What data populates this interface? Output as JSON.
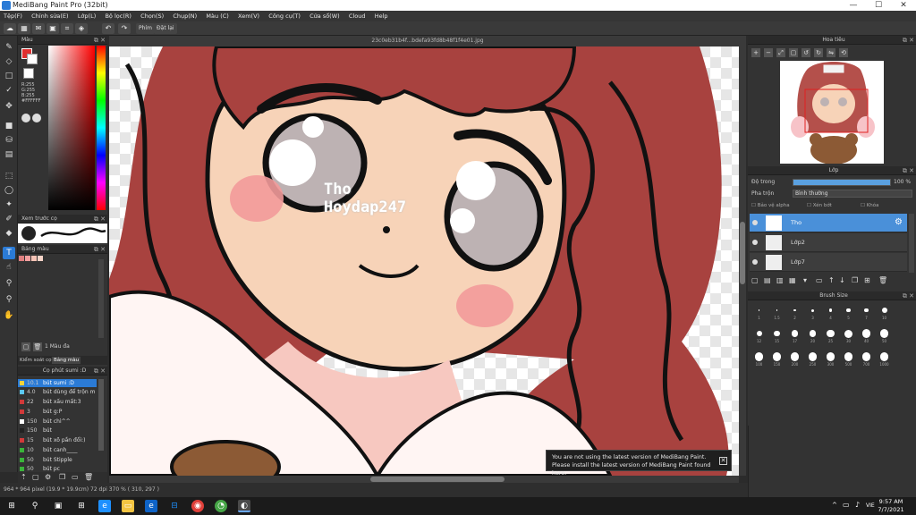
{
  "window": {
    "title": "MediBang Paint Pro (32bit)",
    "controls": [
      "—",
      "☐",
      "✕"
    ]
  },
  "menu": [
    "Tệp(F)",
    "Chỉnh sửa(E)",
    "Lớp(L)",
    "Bộ lọc(R)",
    "Chọn(S)",
    "Chụp(N)",
    "Màu (C)",
    "Xem(V)",
    "Công cụ(T)",
    "Cửa sổ(W)",
    "Cloud",
    "Help"
  ],
  "toolbar": {
    "move_label": "Phím",
    "stabilizer_label": "Đặt lại"
  },
  "panels": {
    "color_title": "Màu",
    "color_values": [
      "R:255",
      "G:255",
      "B:255",
      "#FFFFFF"
    ],
    "brush_preview_title": "Xem trước cọ",
    "palette_title": "Bảng màu",
    "palette_colors": [
      "#e08080",
      "#f4a0a0",
      "#f7c3b5",
      "#f6d4c8"
    ],
    "palette_tabs": [
      "Kiểm soát cọ",
      "Bảng màu"
    ],
    "palette_footer_label": "1 Màu đa",
    "brushlist_title": "Cọ phút sumi :D",
    "navigator_title": "Hoa tiêu",
    "layer_title": "Lớp",
    "opacity_label": "Độ trong",
    "opacity_value": "100 %",
    "blend_label": "Pha trộn",
    "blend_value": "Bình thường",
    "layer_checks": [
      "Bảo vệ alpha",
      "Xén bớt",
      "Khóa"
    ],
    "brushsize_title": "Brush Size"
  },
  "brushes": [
    {
      "size": "10.1",
      "name": "bút sumi :D",
      "color": "#f2d33b"
    },
    {
      "size": "4.0",
      "name": "bút dùng để trộn m",
      "color": "#5bc8f5"
    },
    {
      "size": "22",
      "name": "bút xấu mất:3",
      "color": "#d23a3a"
    },
    {
      "size": "3",
      "name": "bút g:P",
      "color": "#d23a3a"
    },
    {
      "size": "150",
      "name": "bút chì^^",
      "color": "#ffffff"
    },
    {
      "size": "150",
      "name": "bút",
      "color": "#222222"
    },
    {
      "size": "15",
      "name": "bút xõ pần đổi:)",
      "color": "#d23a3a"
    },
    {
      "size": "10",
      "name": "bút canh____",
      "color": "#3ab43a"
    },
    {
      "size": "50",
      "name": "bút Stipple",
      "color": "#3ab43a"
    },
    {
      "size": "50",
      "name": "bút pc",
      "color": "#3ab43a"
    }
  ],
  "layers": [
    {
      "name": "Tho",
      "selected": true
    },
    {
      "name": "Lớp2",
      "selected": false
    },
    {
      "name": "Lớp7",
      "selected": false
    }
  ],
  "brush_sizes": {
    "row1": [
      "1",
      "1.5",
      "2",
      "3",
      "4",
      "5",
      "7",
      "10"
    ],
    "row2": [
      "12",
      "15",
      "17",
      "20",
      "25",
      "30",
      "40",
      "50"
    ],
    "row3": [
      "100",
      "150",
      "200",
      "250",
      "300",
      "500",
      "700",
      "1000"
    ]
  },
  "canvas": {
    "filename": "23c0eb31b4f...bdefa93fd8b48f1f4e01.jpg",
    "watermark_line1": "Tho",
    "watermark_line2": "Hoydap247"
  },
  "notice": {
    "line1": "You are not using the latest version of MediBang Paint.",
    "line2": "Please install the latest version of MediBang Paint found here."
  },
  "status": "964 * 964 pixel  (19.9 * 19.9cm)  72 dpi  370 %  ( 310, 297 )",
  "taskbar": {
    "time": "9:57 AM",
    "date": "7/7/2021",
    "lang": "VIE"
  },
  "colors": {
    "accent": "#2b7bd6",
    "layer_selected": "#4a90d9",
    "hair": "#a8423f",
    "skin": "#f7d3b8",
    "blush": "#f29a9a"
  }
}
